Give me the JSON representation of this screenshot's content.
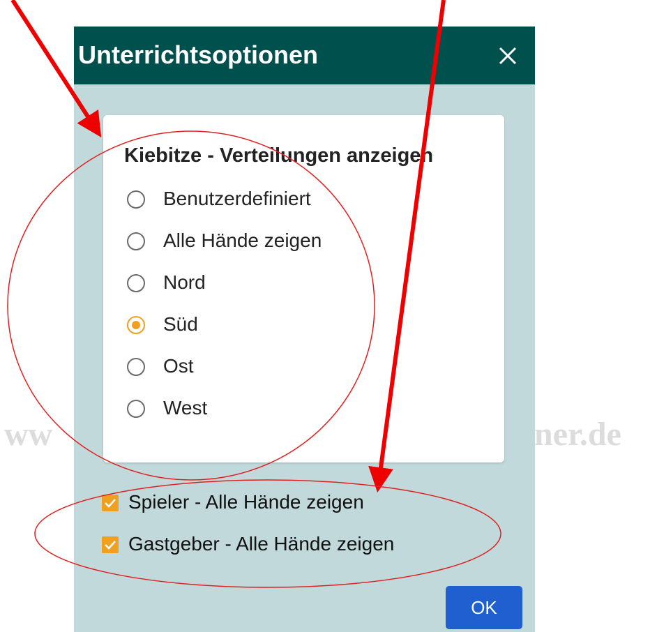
{
  "watermark": {
    "left_text": "ww",
    "right_text": "ner.de"
  },
  "dialog": {
    "title": "Unterrichtsoptionen",
    "close_icon": "close-icon",
    "section_title": "Kiebitze - Verteilungen anzeigen",
    "radio_options": [
      {
        "label": "Benutzerdefiniert",
        "checked": false
      },
      {
        "label": "Alle Hände zeigen",
        "checked": false
      },
      {
        "label": "Nord",
        "checked": false
      },
      {
        "label": "Süd",
        "checked": true
      },
      {
        "label": "Ost",
        "checked": false
      },
      {
        "label": "West",
        "checked": false
      }
    ],
    "checkboxes": [
      {
        "label": "Spieler - Alle Hände zeigen",
        "checked": true
      },
      {
        "label": "Gastgeber - Alle Hände zeigen",
        "checked": true
      }
    ],
    "ok_label": "OK"
  },
  "colors": {
    "header": "#00504e",
    "dialog_background": "#c1d9da",
    "accent": "#f0a020",
    "ok_button": "#1f5fd0",
    "annotation_arrow": "#ee0000",
    "annotation_ellipse": "#e02020"
  }
}
